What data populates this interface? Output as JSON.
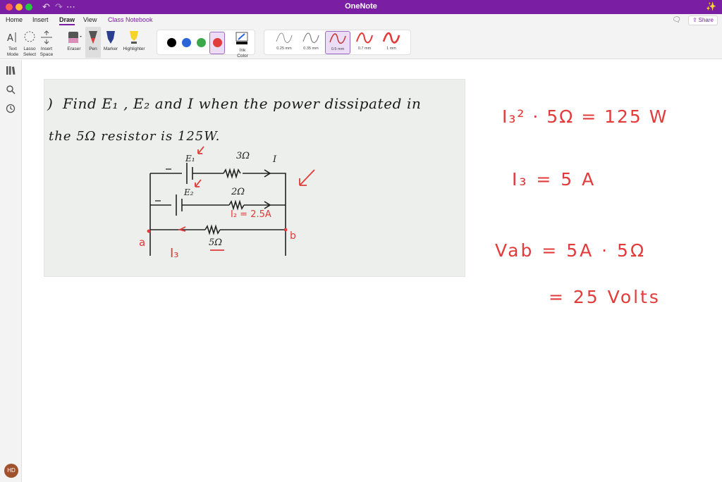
{
  "app": {
    "title": "OneNote"
  },
  "menu": {
    "tabs": [
      "Home",
      "Insert",
      "Draw",
      "View",
      "Class Notebook"
    ],
    "share_label": "Share"
  },
  "ribbon": {
    "tools": [
      {
        "line1": "Text",
        "line2": "Mode"
      },
      {
        "line1": "Lasso",
        "line2": "Select"
      },
      {
        "line1": "Insert",
        "line2": "Space"
      }
    ],
    "eraser_label": "Eraser",
    "pen_label": "Pen",
    "marker_label": "Marker",
    "highlighter_label": "Highlighter",
    "ink_color_line1": "Ink",
    "ink_color_line2": "Color",
    "colors": [
      "#000000",
      "#2b63d9",
      "#3aa84a",
      "#e23b3b"
    ],
    "selected_color": "#e23b3b",
    "thicknesses": [
      "0.25 mm",
      "0.35 mm",
      "0.5 mm",
      "0.7 mm",
      "1 mm"
    ],
    "selected_thickness": "0.5 mm"
  },
  "user": {
    "initials": "HD"
  },
  "note": {
    "problem_line1": "Find E₁ , E₂ and I when the power dissipated in",
    "problem_line2": "the 5Ω resistor is 125W.",
    "circuit": {
      "r1": "3Ω",
      "r2": "2Ω",
      "r3": "5Ω",
      "current_top": "I",
      "e1": "E₁",
      "e2": "E₂",
      "i2_label": "I₂ = 2.5A",
      "node_a": "a",
      "node_b": "b",
      "i3_label": "I₃"
    },
    "solution": {
      "line1": "I₃² · 5Ω = 125 W",
      "line2": "I₃ = 5 A",
      "line3": "Vab = 5A · 5Ω",
      "line4": "= 25 Volts"
    }
  }
}
